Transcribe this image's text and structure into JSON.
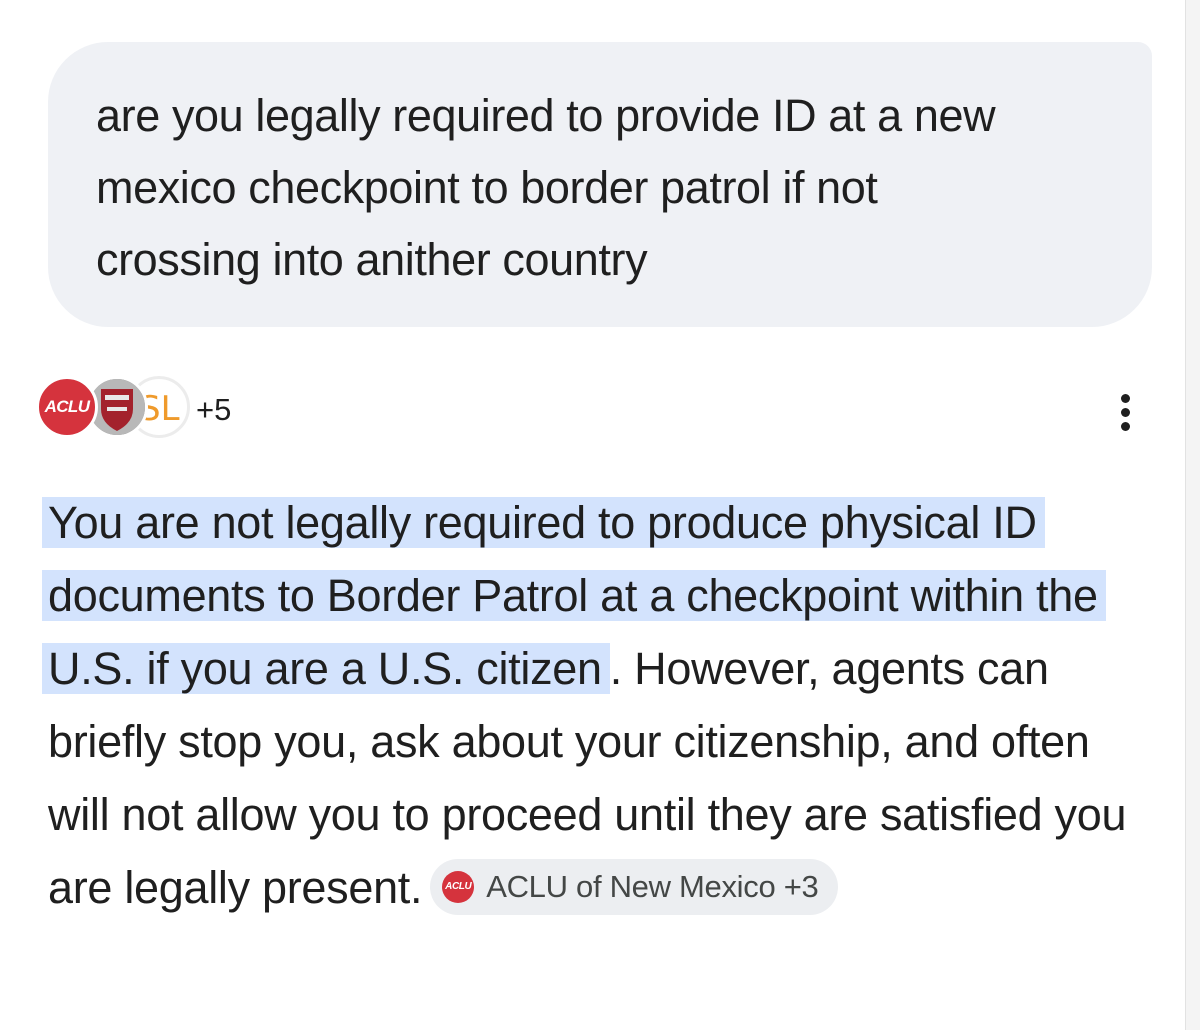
{
  "user_message": {
    "text": "are you legally required to provide ID at a new mexico checkpoint to border patrol if not crossing into anither country"
  },
  "sources": {
    "icons": [
      {
        "name": "aclu-logo-icon",
        "text": "ACLU"
      },
      {
        "name": "shield-logo-icon"
      },
      {
        "name": "sl-logo-icon",
        "text": "SL"
      }
    ],
    "more_count": "+5"
  },
  "answer": {
    "highlighted": "You are not legally required to produce physical ID documents to Border Patrol at a checkpoint within the U.S. if you are a U.S. citizen",
    "rest": ". However, agents can briefly stop you, ask about your citizenship, and often will not allow you to proceed until they are satisfied you are legally present.",
    "citation": {
      "icon_text": "ACLU",
      "label": "ACLU of New Mexico +3"
    }
  },
  "colors": {
    "user_bubble_bg": "#eff1f5",
    "highlight": "#d3e3fd",
    "aclu_red": "#d5333d",
    "sl_orange": "#ef9a2b",
    "chip_bg": "#eceef1"
  }
}
